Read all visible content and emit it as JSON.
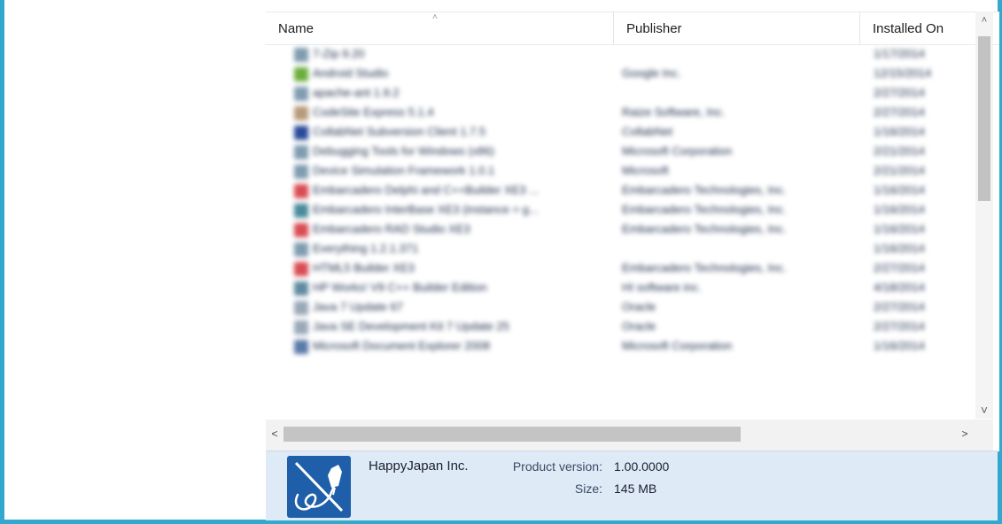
{
  "columns": {
    "name": "Name",
    "publisher": "Publisher",
    "installed_on": "Installed On"
  },
  "rows": [
    {
      "name": "7-Zip 9.20",
      "publisher": "",
      "date": "1/17/2014",
      "icon_color": "#7f9cb0"
    },
    {
      "name": "Android Studio",
      "publisher": "Google Inc.",
      "date": "12/15/2014",
      "icon_color": "#6cae3e"
    },
    {
      "name": "apache-ant 1.9.2",
      "publisher": "",
      "date": "2/27/2014",
      "icon_color": "#7f9cb0"
    },
    {
      "name": "CodeSite Express 5.1.4",
      "publisher": "Raize Software, Inc.",
      "date": "2/27/2014",
      "icon_color": "#b79a7a"
    },
    {
      "name": "CollabNet Subversion Client 1.7.5",
      "publisher": "CollabNet",
      "date": "1/16/2014",
      "icon_color": "#2a4a9a"
    },
    {
      "name": "Debugging Tools for Windows (x86)",
      "publisher": "Microsoft Corporation",
      "date": "2/21/2014",
      "icon_color": "#7f9cb0"
    },
    {
      "name": "Device Simulation Framework 1.0.1",
      "publisher": "Microsoft",
      "date": "2/21/2014",
      "icon_color": "#7f9cb0"
    },
    {
      "name": "Embarcadero Delphi and C++Builder XE3 ...",
      "publisher": "Embarcadero Technologies, Inc.",
      "date": "1/16/2014",
      "icon_color": "#d94b52"
    },
    {
      "name": "Embarcadero InterBase XE3 (instance = g...",
      "publisher": "Embarcadero Technologies, Inc.",
      "date": "1/16/2014",
      "icon_color": "#4a8a9a"
    },
    {
      "name": "Embarcadero RAD Studio XE3",
      "publisher": "Embarcadero Technologies, Inc.",
      "date": "1/16/2014",
      "icon_color": "#d94b52"
    },
    {
      "name": "Everything 1.2.1.371",
      "publisher": "",
      "date": "1/16/2014",
      "icon_color": "#7f9cb0"
    },
    {
      "name": "HTML5 Builder XE3",
      "publisher": "Embarcadero Technologies, Inc.",
      "date": "2/27/2014",
      "icon_color": "#d94b52"
    },
    {
      "name": "HP Works! V9 C++ Builder Edition",
      "publisher": "HI software inc.",
      "date": "4/18/2014",
      "icon_color": "#5f8aa0"
    },
    {
      "name": "Java 7 Update 67",
      "publisher": "Oracle",
      "date": "2/27/2014",
      "icon_color": "#9aa8b8"
    },
    {
      "name": "Java SE Development Kit 7 Update 25",
      "publisher": "Oracle",
      "date": "2/27/2014",
      "icon_color": "#9aa8b8"
    },
    {
      "name": "Microsoft Document Explorer 2008",
      "publisher": "Microsoft Corporation",
      "date": "1/16/2014",
      "icon_color": "#5a7aa8"
    }
  ],
  "details": {
    "app_name": "HappyJapan Inc.",
    "version_label": "Product version:",
    "version_value": "1.00.0000",
    "size_label": "Size:",
    "size_value": "145 MB",
    "icon": "happyjapan-app-icon",
    "icon_color": "#1f5ea8"
  },
  "scrollbars": {
    "up": "▲",
    "down": "⌄",
    "left": "<",
    "right": ">",
    "up_icon": "chevron-up-icon",
    "down_icon": "chevron-down-icon",
    "left_icon": "chevron-left-icon",
    "right_icon": "chevron-right-icon"
  },
  "accent_color": "#33a8cf"
}
